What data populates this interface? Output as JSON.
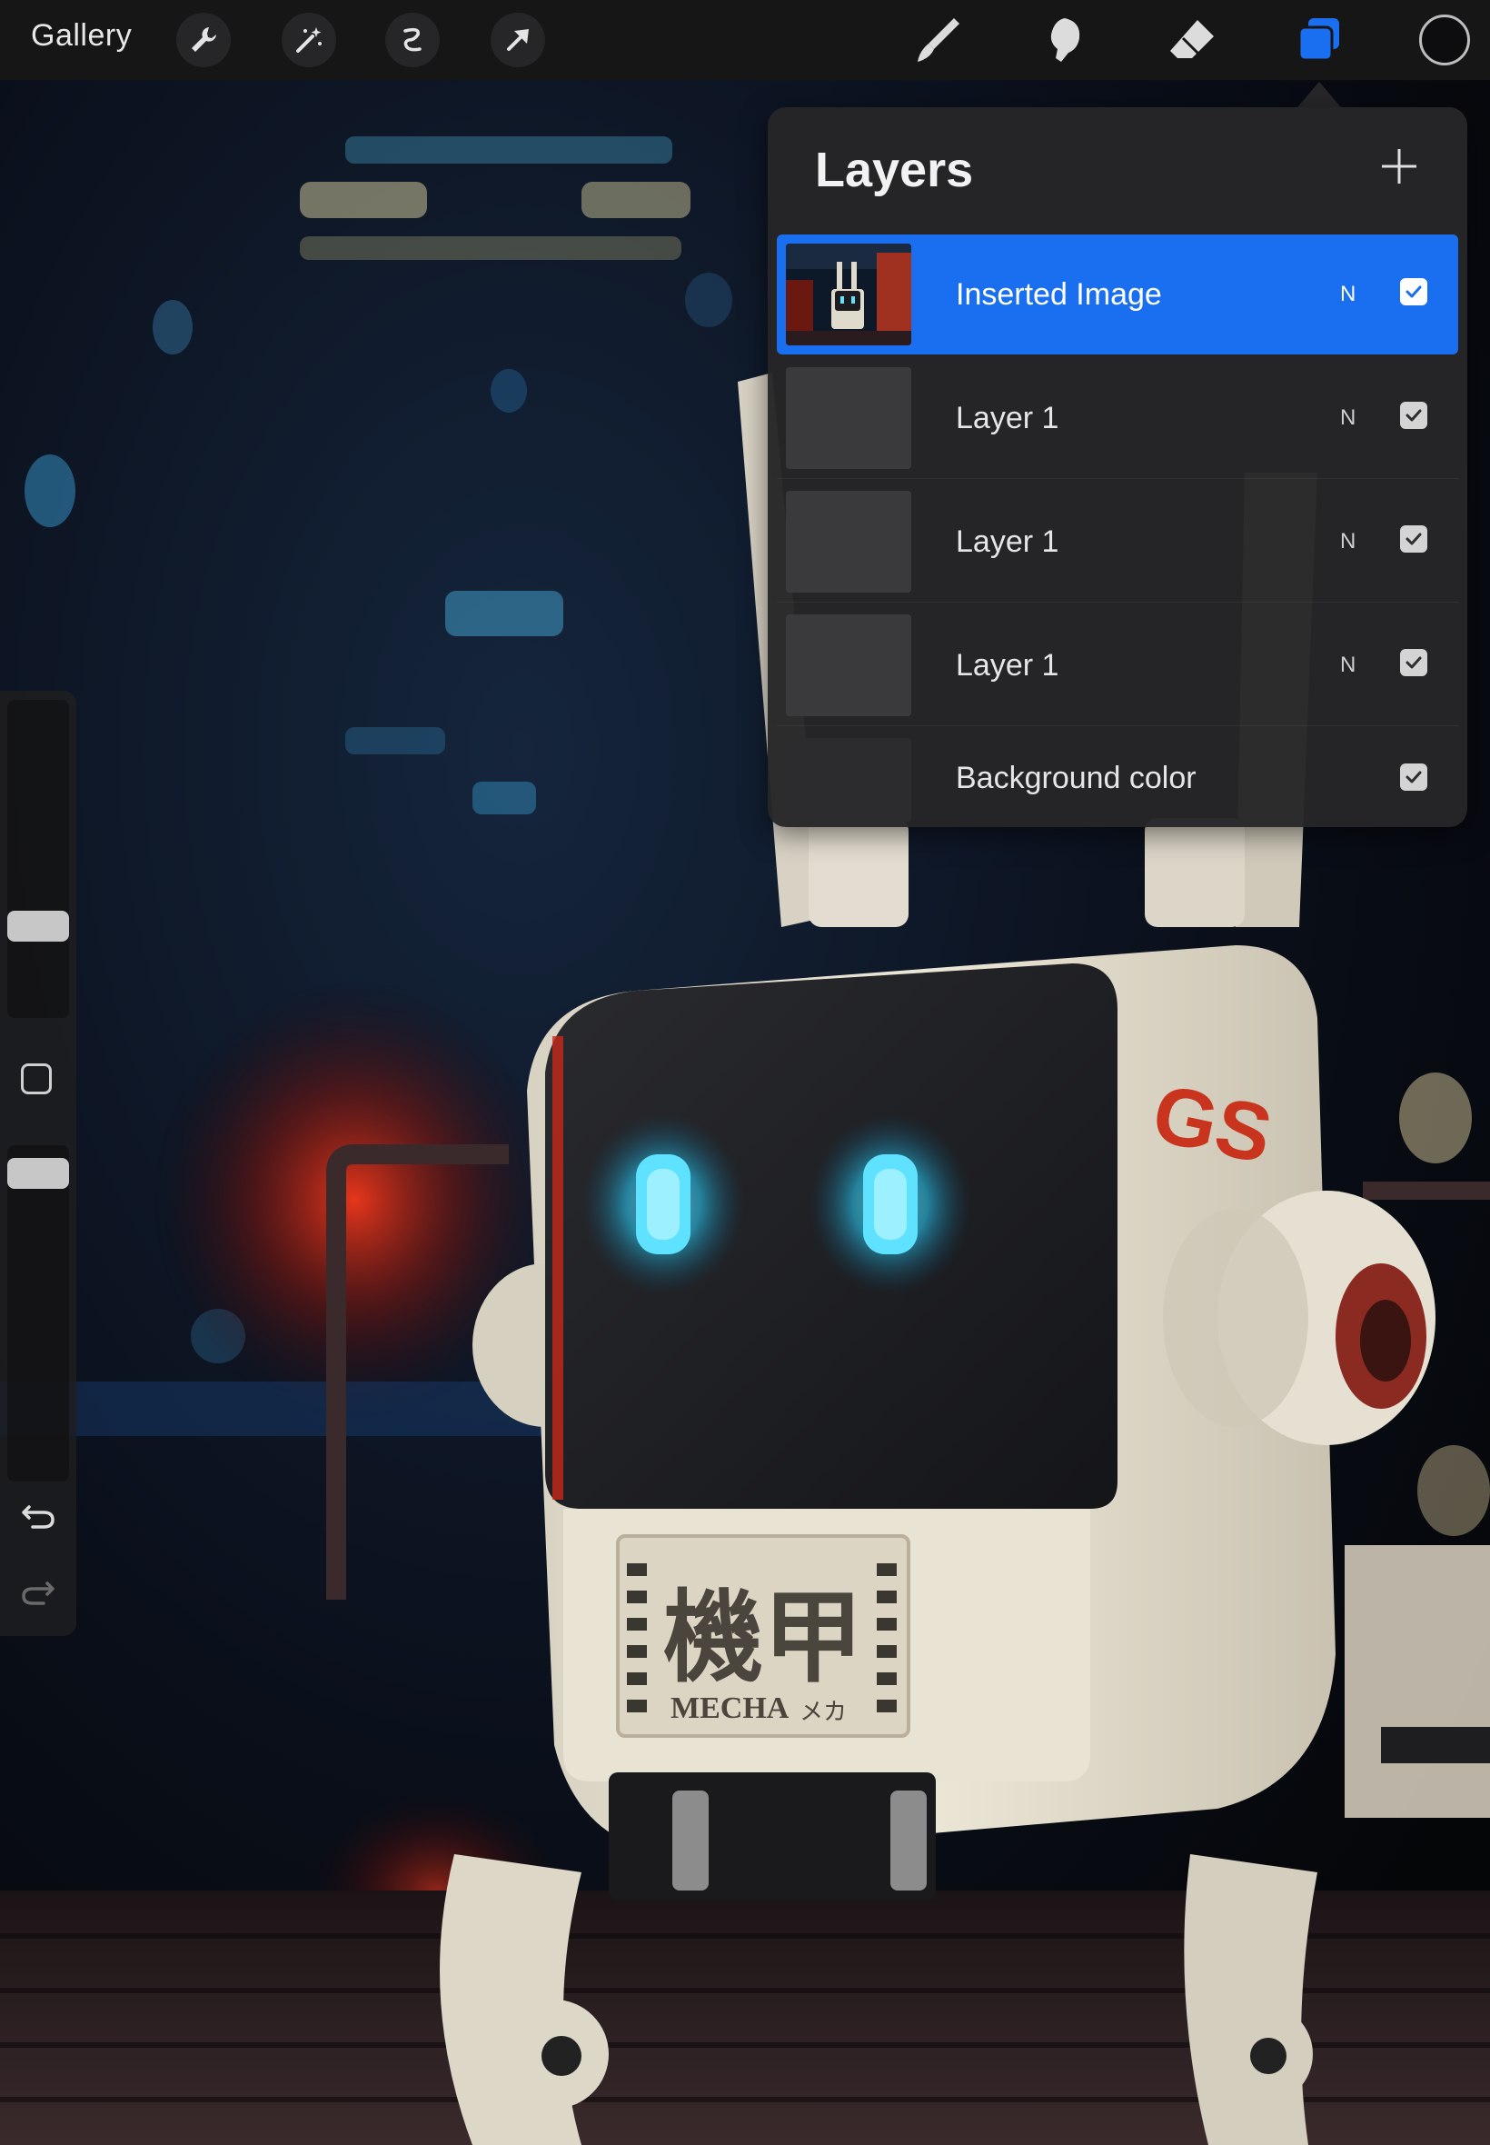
{
  "topbar": {
    "gallery_label": "Gallery",
    "left_tools": [
      "wrench-icon",
      "magic-wand-icon",
      "selection-icon",
      "transform-arrow-icon"
    ],
    "right_tools": [
      "brush-icon",
      "smudge-icon",
      "eraser-icon",
      "layers-icon"
    ],
    "active_tool": "layers-icon",
    "accent_color": "#1a6ff0",
    "current_color": "#0d0d0f"
  },
  "sidebar": {
    "tools": [
      "brush-size-slider",
      "modify-button",
      "opacity-slider",
      "undo-icon",
      "redo-icon"
    ]
  },
  "layers_panel": {
    "title": "Layers",
    "add_icon": "plus-icon",
    "layers": [
      {
        "name": "Inserted Image",
        "blend": "N",
        "visible": true,
        "selected": true
      },
      {
        "name": "Layer 1",
        "blend": "N",
        "visible": true,
        "selected": false
      },
      {
        "name": "Layer 1",
        "blend": "N",
        "visible": true,
        "selected": false
      },
      {
        "name": "Layer 1",
        "blend": "N",
        "visible": true,
        "selected": false
      },
      {
        "name": "Background color",
        "blend": "",
        "visible": true,
        "selected": false
      }
    ]
  },
  "artwork": {
    "label_kanji": "機甲",
    "label_latin": "MECHA",
    "label_kana": "メカ",
    "side_marking": "GS"
  }
}
